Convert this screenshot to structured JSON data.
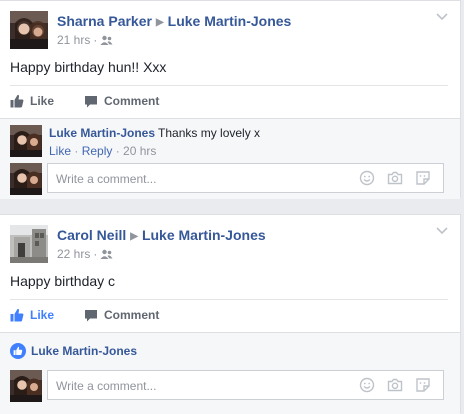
{
  "posts": [
    {
      "author": "Sharna Parker",
      "target": "Luke Martin-Jones",
      "time": "21 hrs",
      "text": "Happy birthday hun!! Xxx",
      "actions": {
        "like": "Like",
        "comment": "Comment",
        "liked": false
      },
      "comments": [
        {
          "author": "Luke Martin-Jones",
          "text": "Thanks my lovely x",
          "like": "Like",
          "reply": "Reply",
          "time": "20 hrs"
        }
      ],
      "composer_placeholder": "Write a comment..."
    },
    {
      "author": "Carol Neill",
      "target": "Luke Martin-Jones",
      "time": "22 hrs",
      "text": "Happy birthday c",
      "actions": {
        "like": "Like",
        "comment": "Comment",
        "liked": true
      },
      "likers": "Luke Martin-Jones",
      "composer_placeholder": "Write a comment..."
    }
  ],
  "colors": {
    "link": "#365899",
    "liked": "#4080ff",
    "meta": "#90949c",
    "background": "#e9ebee"
  },
  "icons": [
    "friends-audience-icon",
    "chevron-down-icon",
    "thumbs-up-icon",
    "comment-icon",
    "smiley-icon",
    "camera-icon",
    "sticker-icon",
    "like-reaction-icon"
  ]
}
